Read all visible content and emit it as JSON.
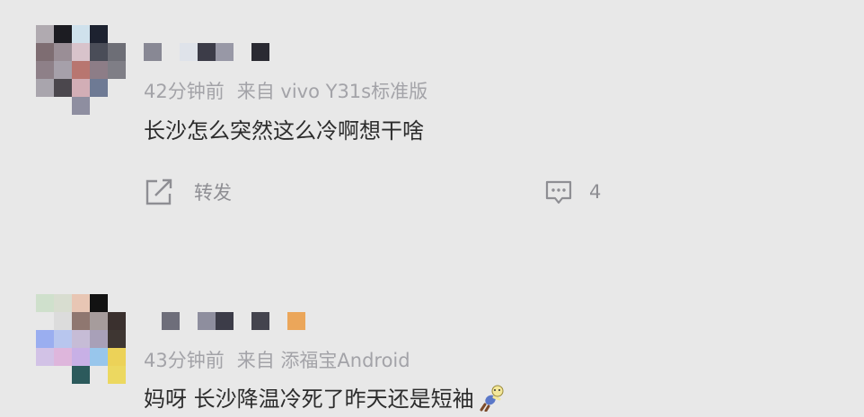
{
  "posts": [
    {
      "time": "42分钟前",
      "source": "来自 vivo Y31s标准版",
      "text": "长沙怎么突然这么冷啊想干啥",
      "repost_label": "转发",
      "comment_count": "4"
    },
    {
      "time": "43分钟前",
      "source": "来自 添福宝Android",
      "text": "妈呀 长沙降温冷死了昨天还是短袖"
    }
  ],
  "icons": {
    "repost": "share-square-arrow-icon",
    "comment": "speech-bubble-dots-icon",
    "emoji": "teddy-bear-emoji"
  },
  "colors": {
    "background": "#e8e8e8",
    "text": "#2c2c2c",
    "meta": "#a3a3a8",
    "action": "#8e8e93"
  }
}
